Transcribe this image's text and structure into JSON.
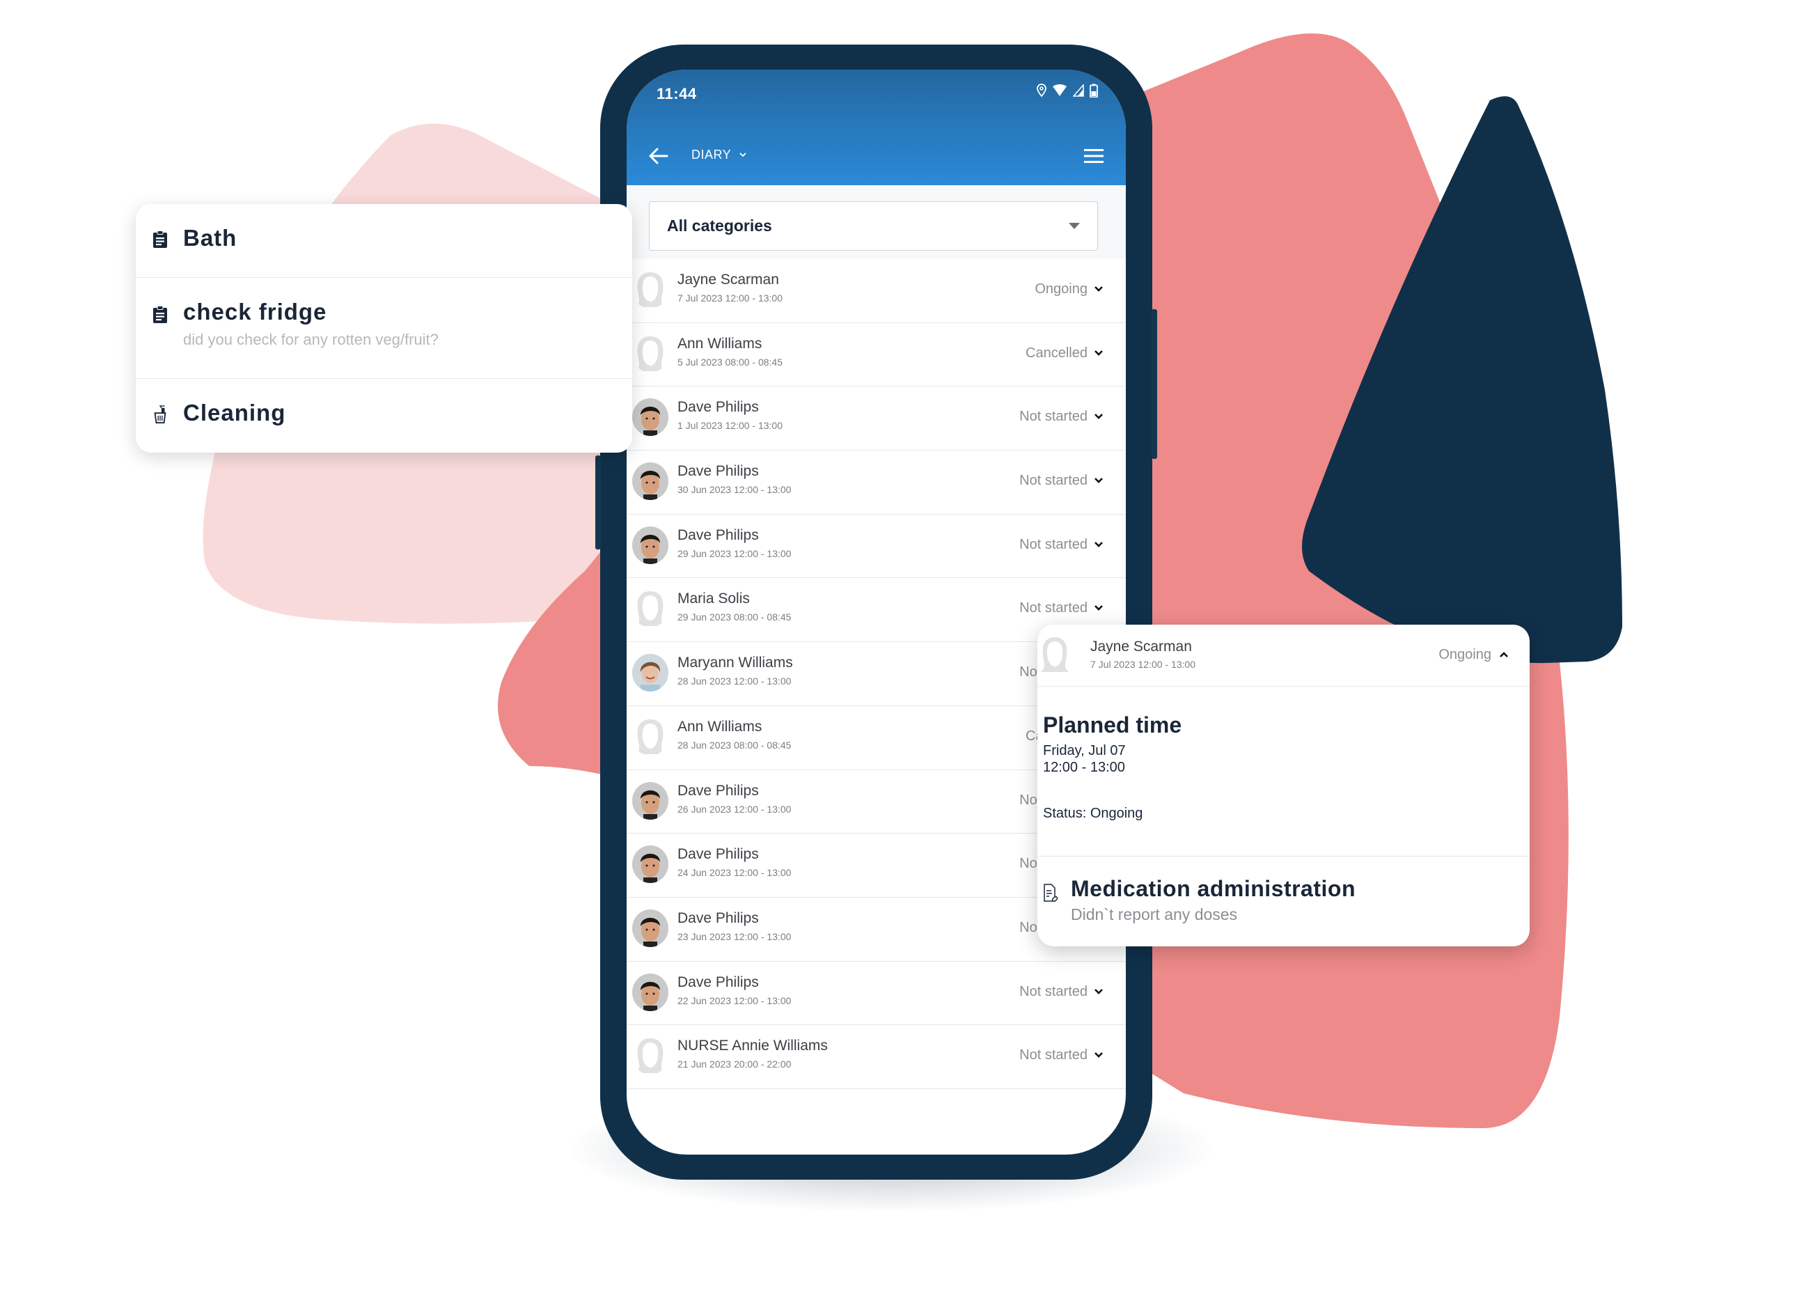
{
  "colors": {
    "coral": "#ee8a89",
    "pink_light": "#f9dada",
    "navy": "#10304a",
    "appbar_top": "#2467a0",
    "appbar_bottom": "#2b8ad8",
    "text_dark": "#1a2638",
    "text_muted": "#8a8e93"
  },
  "phone": {
    "status_bar": {
      "time": "11:44",
      "icons": [
        "location-icon",
        "wifi-icon",
        "signal-icon",
        "battery-icon"
      ]
    },
    "appbar": {
      "back_icon": "arrow-left-icon",
      "title": "DIARY",
      "title_icon": "chevron-down-icon",
      "menu_icon": "hamburger-menu-icon"
    },
    "filter": {
      "selected": "All categories",
      "icon": "dropdown-triangle-icon"
    },
    "visits": [
      {
        "name": "Jayne Scarman",
        "date": "7 Jul 2023 12:00 - 13:00",
        "status": "Ongoing",
        "avatar": "placeholder"
      },
      {
        "name": "Ann Williams",
        "date": "5 Jul 2023 08:00 - 08:45",
        "status": "Cancelled",
        "avatar": "placeholder"
      },
      {
        "name": "Dave Philips",
        "date": "1 Jul 2023 12:00 - 13:00",
        "status": "Not started",
        "avatar": "photo-male"
      },
      {
        "name": "Dave Philips",
        "date": "30 Jun 2023 12:00 - 13:00",
        "status": "Not started",
        "avatar": "photo-male"
      },
      {
        "name": "Dave Philips",
        "date": "29 Jun 2023 12:00 - 13:00",
        "status": "Not started",
        "avatar": "photo-male"
      },
      {
        "name": "Maria Solis",
        "date": "29 Jun 2023 08:00 - 08:45",
        "status": "Not started",
        "avatar": "placeholder"
      },
      {
        "name": "Maryann Williams",
        "date": "28 Jun 2023 12:00 - 13:00",
        "status": "Not started",
        "avatar": "photo-female"
      },
      {
        "name": "Ann Williams",
        "date": "28 Jun 2023 08:00 - 08:45",
        "status": "Cancelled",
        "avatar": "placeholder"
      },
      {
        "name": "Dave Philips",
        "date": "26 Jun 2023 12:00 - 13:00",
        "status": "Not started",
        "avatar": "photo-male"
      },
      {
        "name": "Dave Philips",
        "date": "24 Jun 2023 12:00 - 13:00",
        "status": "Not started",
        "avatar": "photo-male"
      },
      {
        "name": "Dave Philips",
        "date": "23 Jun 2023 12:00 - 13:00",
        "status": "Not started",
        "avatar": "photo-male"
      },
      {
        "name": "Dave Philips",
        "date": "22 Jun 2023 12:00 - 13:00",
        "status": "Not started",
        "avatar": "photo-male"
      },
      {
        "name": "NURSE Annie Williams",
        "date": "21 Jun 2023 20:00 - 22:00",
        "status": "Not started",
        "avatar": "placeholder"
      }
    ]
  },
  "task_card": {
    "items": [
      {
        "title": "Bath",
        "subtitle": "",
        "icon": "clipboard-icon"
      },
      {
        "title": "check fridge",
        "subtitle": "did you check for any rotten veg/fruit?",
        "icon": "clipboard-icon"
      },
      {
        "title": "Cleaning",
        "subtitle": "",
        "icon": "cleaning-bucket-icon"
      }
    ]
  },
  "detail_card": {
    "name": "Jayne Scarman",
    "date": "7 Jul 2023 12:00 - 13:00",
    "status": "Ongoing",
    "status_icon": "chevron-up-icon",
    "section_title": "Planned time",
    "day": "Friday, Jul 07",
    "time": "12:00 - 13:00",
    "status_line": "Status: Ongoing",
    "task_title": "Medication administration",
    "task_subtitle": "Didn`t report any doses",
    "task_icon": "medication-document-icon"
  }
}
